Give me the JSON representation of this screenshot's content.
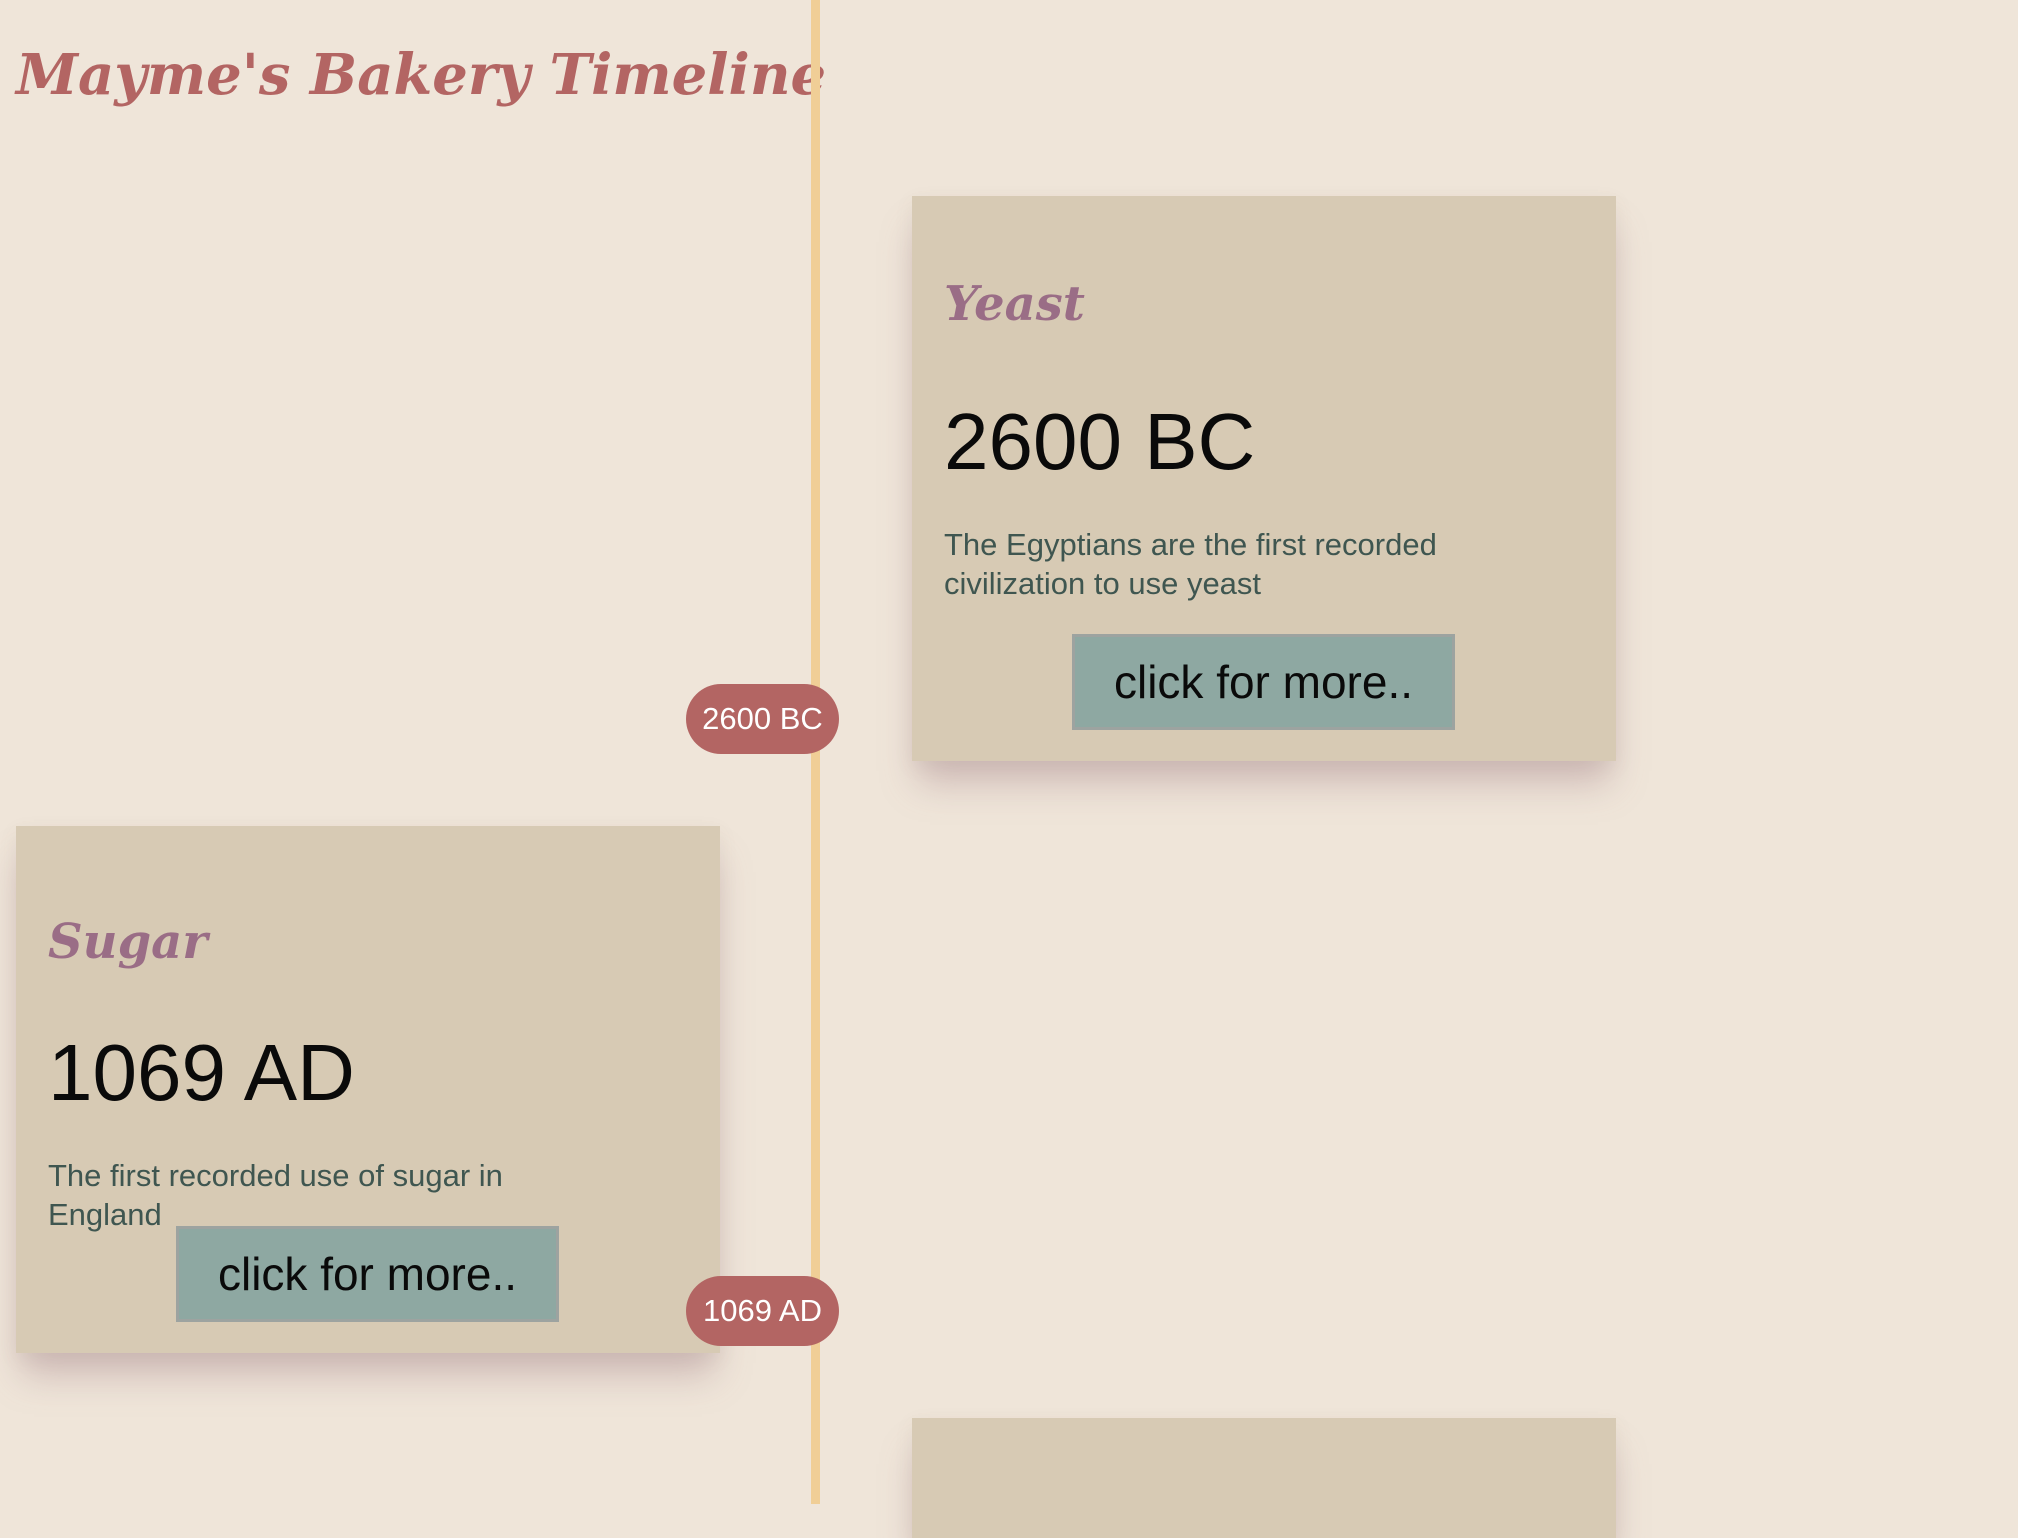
{
  "page": {
    "title": "Mayme's Bakery Timeline"
  },
  "colors": {
    "background": "#efe5d9",
    "title": "#b36563",
    "timeline_line": "#f0ce96",
    "card_background": "#d7cab4",
    "card_heading": "#9a6d86",
    "description_text": "#3f5650",
    "button_background": "#8ea8a2",
    "date_pill": "#b36563"
  },
  "timeline": {
    "events": [
      {
        "heading": "Yeast",
        "date": "2600 BC",
        "description": "The Egyptians are the first recorded civilization to use yeast",
        "button_label": "click for more..",
        "marker_label": "2600 BC",
        "side": "right"
      },
      {
        "heading": "Sugar",
        "date": "1069 AD",
        "description": "The first recorded use of sugar in England",
        "button_label": "click for more..",
        "marker_label": "1069 AD",
        "side": "left"
      }
    ]
  }
}
